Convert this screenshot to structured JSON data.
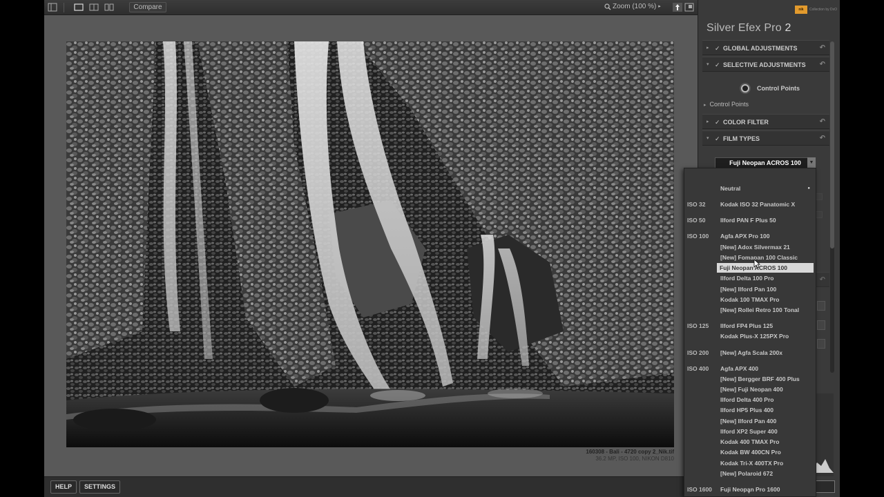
{
  "toolbar": {
    "compare_label": "Compare",
    "zoom_label": "Zoom (100 %)"
  },
  "photo": {
    "filename": "160308 - Bali - 4720 copy 2_Nik.tif",
    "meta": "36.2 MP, ISO 100, NIKON D810"
  },
  "bottombar": {
    "help_label": "HELP",
    "settings_label": "SETTINGS"
  },
  "panel": {
    "app_title": "Silver Efex Pro",
    "app_version": "2",
    "logo_box": "nik",
    "logo_text": "Collection by DxO",
    "sections": {
      "global": "GLOBAL ADJUSTMENTS",
      "selective": "SELECTIVE ADJUSTMENTS",
      "color_filter": "COLOR FILTER",
      "film_types": "FILM TYPES"
    },
    "control_points_button": "Control Points",
    "control_points_sub": "Control Points",
    "film_selected": "Fuji Neopan ACROS 100"
  },
  "film_list": [
    {
      "iso": "",
      "name": "Neutral",
      "dot": true
    },
    {
      "iso": "ISO 32",
      "name": "Kodak ISO 32 Panatomic X"
    },
    {
      "iso": "ISO 50",
      "name": "Ilford PAN F Plus 50"
    },
    {
      "iso": "ISO 100",
      "name": "Agfa APX Pro 100"
    },
    {
      "iso": "",
      "name": "[New] Adox Silvermax 21"
    },
    {
      "iso": "",
      "name": "[New] Fomapan 100 Classic"
    },
    {
      "iso": "",
      "name": "Fuji Neopan ACROS 100",
      "selected": true
    },
    {
      "iso": "",
      "name": "Ilford Delta 100 Pro"
    },
    {
      "iso": "",
      "name": "[New] Ilford Pan 100"
    },
    {
      "iso": "",
      "name": "Kodak 100 TMAX Pro"
    },
    {
      "iso": "",
      "name": "[New] Rollei Retro 100 Tonal"
    },
    {
      "iso": "ISO 125",
      "name": "Ilford FP4 Plus 125"
    },
    {
      "iso": "",
      "name": "Kodak Plus-X 125PX Pro"
    },
    {
      "iso": "ISO 200",
      "name": "[New] Agfa Scala 200x"
    },
    {
      "iso": "ISO 400",
      "name": "Agfa APX 400"
    },
    {
      "iso": "",
      "name": "[New] Bergger BRF 400 Plus"
    },
    {
      "iso": "",
      "name": "[New] Fuji Neopan 400"
    },
    {
      "iso": "",
      "name": "Ilford Delta 400 Pro"
    },
    {
      "iso": "",
      "name": "Ilford HP5 Plus 400"
    },
    {
      "iso": "",
      "name": "[New] Ilford Pan 400"
    },
    {
      "iso": "",
      "name": "Ilford XP2 Super 400"
    },
    {
      "iso": "",
      "name": "Kodak 400 TMAX Pro"
    },
    {
      "iso": "",
      "name": "Kodak BW 400CN Pro"
    },
    {
      "iso": "",
      "name": "Kodak Tri-X 400TX Pro"
    },
    {
      "iso": "",
      "name": "[New] Polaroid 672"
    },
    {
      "iso": "ISO 1600",
      "name": "Fuji Neopan Pro 1600"
    }
  ]
}
